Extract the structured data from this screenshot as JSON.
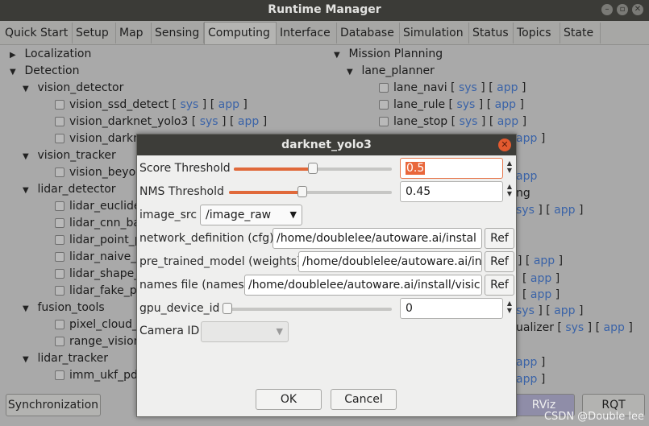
{
  "window": {
    "title": "Runtime Manager"
  },
  "tabs": [
    "Quick Start",
    "Setup",
    "Map",
    "Sensing",
    "Computing",
    "Interface",
    "Database",
    "Simulation",
    "Status",
    "Topics",
    "State"
  ],
  "active_tab": "Computing",
  "links": {
    "sys": "sys",
    "app": "app",
    "lb": "[",
    "rb": "]"
  },
  "left_tree": {
    "localization": "Localization",
    "detection": "Detection",
    "vision_detector": "vision_detector",
    "vision_ssd_detect": "vision_ssd_detect",
    "vision_darknet_yolo3": "vision_darknet_yolo3",
    "vision_darkn": "vision_darkn",
    "vision_tracker": "vision_tracker",
    "vision_beyo": "vision_beyor",
    "lidar_detector": "lidar_detector",
    "lidar_euclide": "lidar_euclide",
    "lidar_cnn_ba": "lidar_cnn_ba",
    "lidar_point_p": "lidar_point_p",
    "lidar_naive_l": "lidar_naive_l",
    "lidar_shape_": "lidar_shape_",
    "lidar_fake_p": "lidar_fake_p",
    "fusion_tools": "fusion_tools",
    "pixel_cloud": "pixel_cloud_",
    "range_vision": "range_vision",
    "lidar_tracker": "lidar_tracker",
    "imm_ukf_pd": "imm_ukf_pd"
  },
  "right_tree": {
    "mission_planning": "Mission Planning",
    "lane_planner": "lane_planner",
    "lane_navi": "lane_navi",
    "lane_rule": "lane_rule",
    "lane_stop": "lane_stop",
    "ng": "ng",
    "ualizer": "ualizer"
  },
  "bottom": {
    "synchronization": "Synchronization",
    "rviz": "RViz",
    "rqt": "RQT"
  },
  "watermark": "CSDN @Double lee",
  "dialog": {
    "title": "darknet_yolo3",
    "score_threshold_label": "Score Threshold",
    "score_threshold_value": "0.5",
    "score_threshold_level": 0.5,
    "nms_threshold_label": "NMS Threshold",
    "nms_threshold_value": "0.45",
    "nms_threshold_level": 0.45,
    "image_src_label": "image_src",
    "image_src_value": "/image_raw",
    "network_definition_label": "network_definition (cfg)",
    "network_definition_value": "/home/doublelee/autoware.ai/instal",
    "pre_trained_model_label": "pre_trained_model (weights)",
    "pre_trained_model_value": "/home/doublelee/autoware.ai/in",
    "names_file_label": "names file (names)",
    "names_file_value": "/home/doublelee/autoware.ai/install/visic",
    "gpu_device_id_label": "gpu_device_id",
    "gpu_device_id_value": "0",
    "gpu_device_id_level": 0,
    "camera_id_label": "Camera ID",
    "ref_label": "Ref",
    "ok_label": "OK",
    "cancel_label": "Cancel"
  },
  "colors": {
    "accent": "#e9673b",
    "link": "#3a63a8",
    "titlebar": "#3b3b37"
  }
}
